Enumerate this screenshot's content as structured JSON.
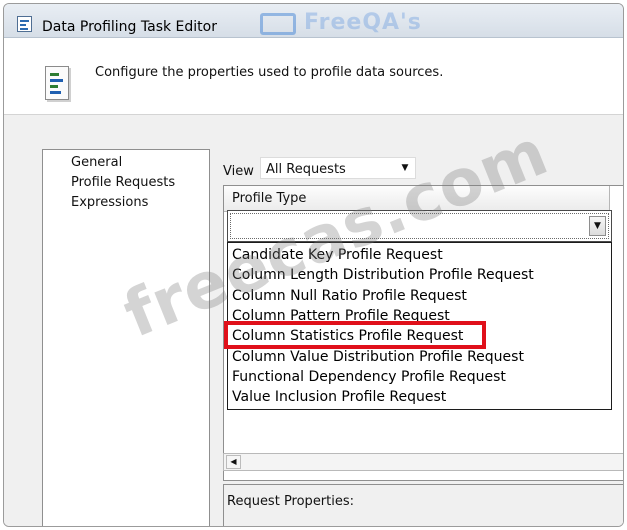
{
  "window": {
    "title": "Data Profiling Task Editor"
  },
  "watermarks": {
    "logo_text": "FreeQA's",
    "site_text": "freecas.com"
  },
  "header": {
    "description": "Configure the properties used to profile data sources.",
    "icon": "data-profile-document-icon"
  },
  "nav": {
    "items": [
      {
        "label": "General",
        "selected": false
      },
      {
        "label": "Profile Requests",
        "selected": true
      },
      {
        "label": "Expressions",
        "selected": false
      }
    ]
  },
  "view": {
    "label": "View",
    "selected": "All Requests"
  },
  "grid": {
    "column_header": "Profile Type",
    "combo_value": ""
  },
  "dropdown": {
    "options": [
      "Candidate Key Profile Request",
      "Column Length Distribution Profile Request",
      "Column Null Ratio Profile Request",
      "Column Pattern Profile Request",
      "Column Statistics Profile Request",
      "Column Value Distribution Profile Request",
      "Functional Dependency Profile Request",
      "Value Inclusion Profile Request"
    ],
    "highlighted_index": 4,
    "highlight_color": "#e0101a"
  },
  "request_properties": {
    "label": "Request Properties:"
  }
}
